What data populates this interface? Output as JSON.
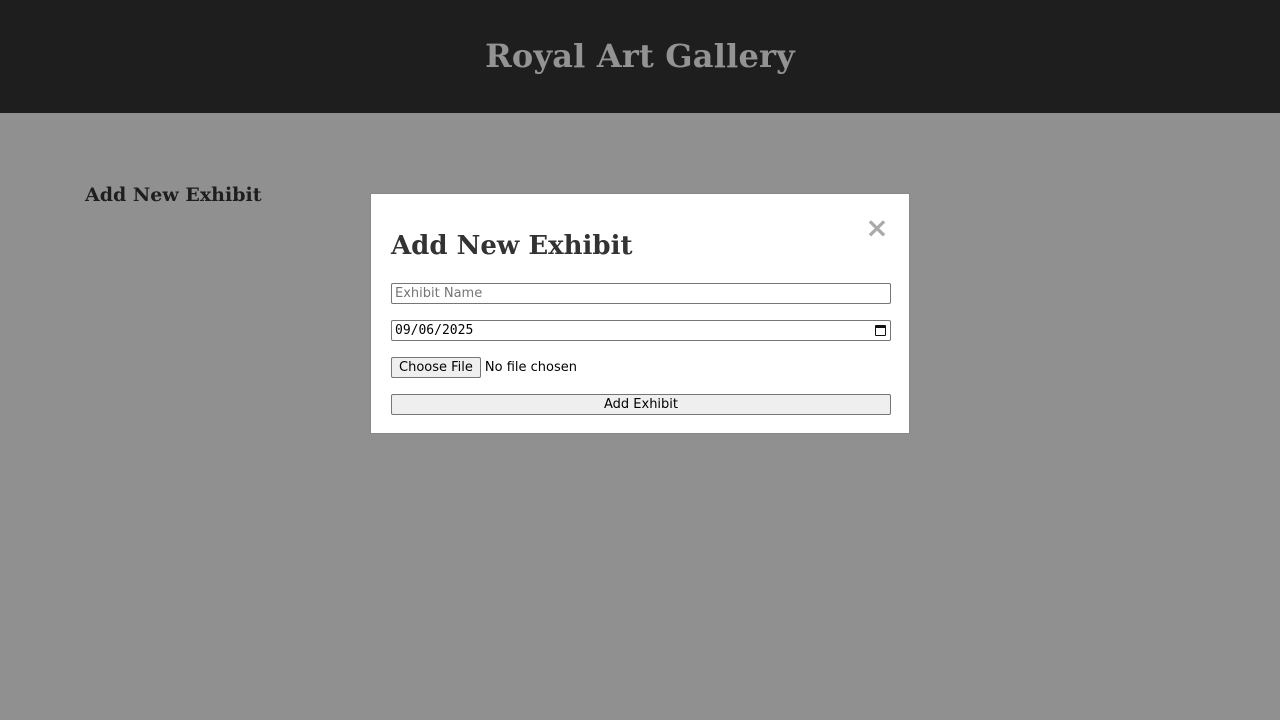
{
  "header": {
    "title": "Royal Art Gallery"
  },
  "main": {
    "section_heading": "Add New Exhibit"
  },
  "modal": {
    "title": "Add New Exhibit",
    "close_glyph": "×",
    "name_field": {
      "placeholder": "Exhibit Name",
      "value": ""
    },
    "date_field": {
      "value": "09/06/2025"
    },
    "file_field": {
      "button_label": "Choose File",
      "status": "No file chosen"
    },
    "submit_label": "Add Exhibit"
  },
  "colors": {
    "header_bg": "#333333",
    "page_bg": "#f0f0f0",
    "overlay": "rgba(0,0,0,0.4)",
    "modal_bg": "#ffffff",
    "title_text": "#333333"
  }
}
